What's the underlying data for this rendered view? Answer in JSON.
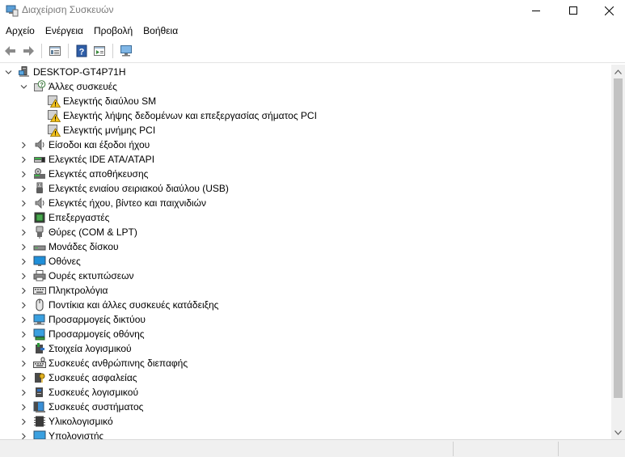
{
  "window": {
    "title": "Διαχείριση Συσκευών"
  },
  "menu": [
    {
      "label": "Αρχείο"
    },
    {
      "label": "Ενέργεια"
    },
    {
      "label": "Προβολή"
    },
    {
      "label": "Βοήθεια"
    }
  ],
  "toolbar": {
    "buttons": [
      "back-arrow-icon",
      "forward-arrow-icon",
      "properties-icon",
      "help-icon",
      "run-icon",
      "monitor-scan-icon"
    ]
  },
  "tree": {
    "root": {
      "label": "DESKTOP-GT4P71H",
      "expanded": true
    },
    "categories": [
      {
        "label": "Άλλες συσκευές",
        "icon": "unknown-device-icon",
        "expanded": true,
        "children": [
          {
            "label": "Ελεγκτής διαύλου SM",
            "icon": "warning-device-icon"
          },
          {
            "label": "Ελεγκτής λήψης δεδομένων και επεξεργασίας σήματος PCI",
            "icon": "warning-device-icon"
          },
          {
            "label": "Ελεγκτής μνήμης PCI",
            "icon": "warning-device-icon"
          }
        ]
      },
      {
        "label": "Είσοδοι και έξοδοι ήχου",
        "icon": "speaker-icon"
      },
      {
        "label": "Ελεγκτές IDE ATA/ATAPI",
        "icon": "ide-controller-icon"
      },
      {
        "label": "Ελεγκτές αποθήκευσης",
        "icon": "storage-controller-icon"
      },
      {
        "label": "Ελεγκτές ενιαίου σειριακού διαύλου (USB)",
        "icon": "usb-icon"
      },
      {
        "label": "Ελεγκτές ήχου, βίντεο και παιχνιδιών",
        "icon": "sound-icon"
      },
      {
        "label": "Επεξεργαστές",
        "icon": "processor-icon"
      },
      {
        "label": "Θύρες (COM & LPT)",
        "icon": "port-icon"
      },
      {
        "label": "Μονάδες δίσκου",
        "icon": "disk-drive-icon"
      },
      {
        "label": "Οθόνες",
        "icon": "monitor-icon"
      },
      {
        "label": "Ουρές εκτυπώσεων",
        "icon": "printer-icon"
      },
      {
        "label": "Πληκτρολόγια",
        "icon": "keyboard-icon"
      },
      {
        "label": "Ποντίκια και άλλες συσκευές κατάδειξης",
        "icon": "mouse-icon"
      },
      {
        "label": "Προσαρμογείς δικτύου",
        "icon": "network-adapter-icon"
      },
      {
        "label": "Προσαρμογείς οθόνης",
        "icon": "display-adapter-icon"
      },
      {
        "label": "Στοιχεία λογισμικού",
        "icon": "software-component-icon"
      },
      {
        "label": "Συσκευές ανθρώπινης διεπαφής",
        "icon": "hid-icon"
      },
      {
        "label": "Συσκευές ασφαλείας",
        "icon": "security-device-icon"
      },
      {
        "label": "Συσκευές λογισμικού",
        "icon": "software-device-icon"
      },
      {
        "label": "Συσκευές συστήματος",
        "icon": "system-device-icon"
      },
      {
        "label": "Υλικολογισμικό",
        "icon": "firmware-icon"
      },
      {
        "label": "Υπολογιστής",
        "icon": "computer-icon"
      }
    ]
  }
}
